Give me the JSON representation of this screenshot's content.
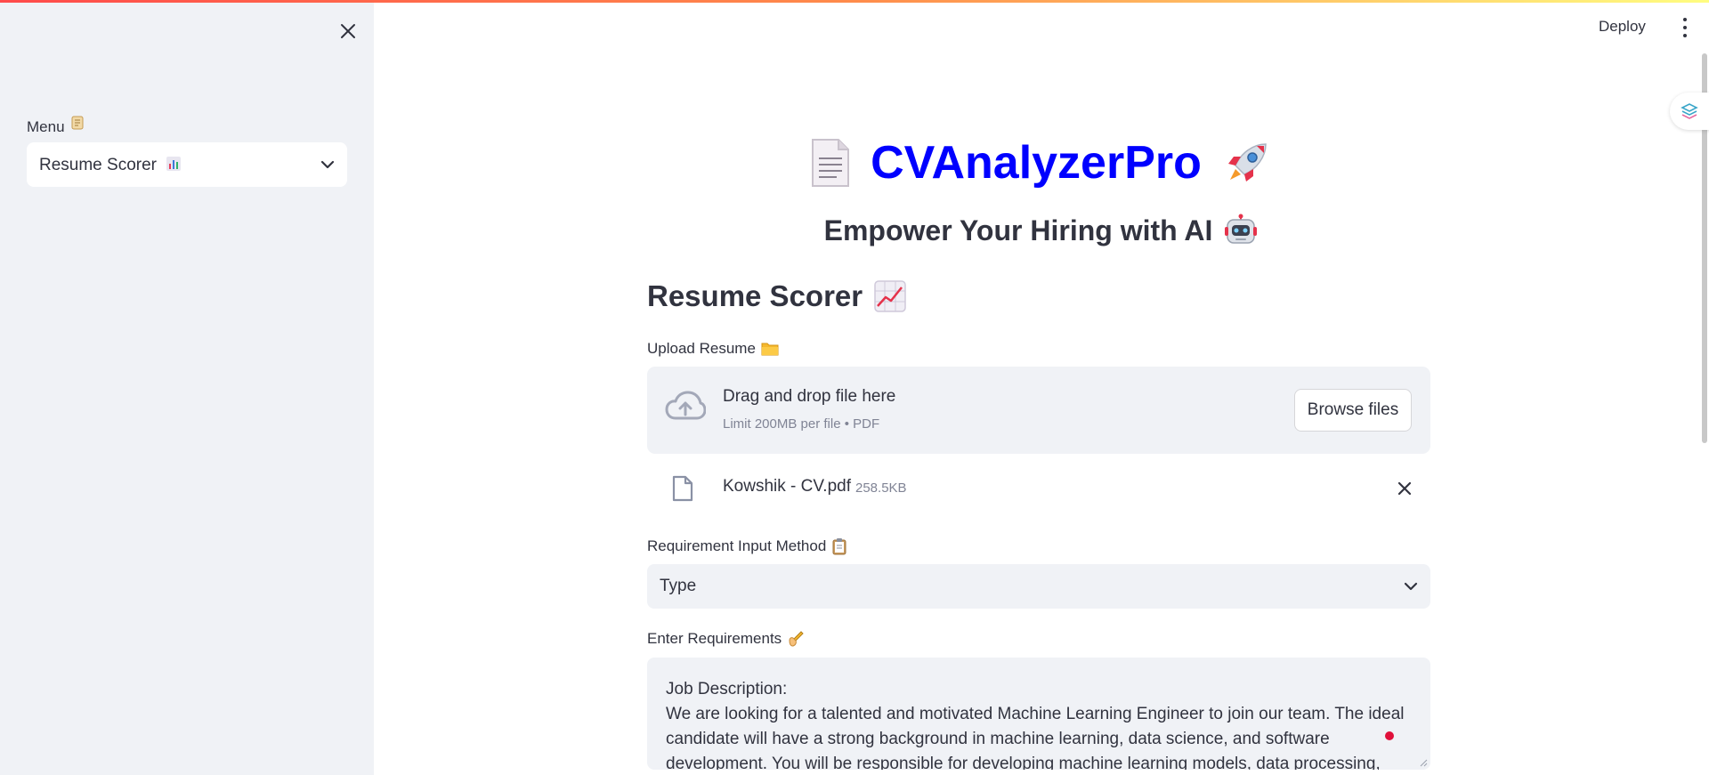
{
  "sidebar": {
    "menu_label": "Menu",
    "menu_selected": "Resume Scorer"
  },
  "header": {
    "deploy_label": "Deploy"
  },
  "main": {
    "title": "CVAnalyzerPro",
    "subtitle": "Empower Your Hiring with AI",
    "section_title": "Resume Scorer",
    "upload": {
      "label": "Upload Resume",
      "drop_text": "Drag and drop file here",
      "limit_text": "Limit 200MB per file • PDF",
      "browse_label": "Browse files"
    },
    "uploaded_file": {
      "name": "Kowshik - CV.pdf",
      "size": "258.5KB"
    },
    "requirement_method": {
      "label": "Requirement Input Method",
      "selected": "Type"
    },
    "requirements": {
      "label": "Enter Requirements",
      "line1": "Job Description:",
      "body": "We are looking for a talented and motivated Machine Learning Engineer to join our team. The ideal candidate will have a strong background in machine learning, data science, and software development. You will be responsible for developing machine learning models, data processing,"
    }
  },
  "colors": {
    "title": "#0000ff",
    "sidebar_bg": "#f0f2f6",
    "text": "#31333f",
    "muted": "#808495"
  },
  "icons": [
    "close-icon",
    "chevron-down-icon",
    "kebab-menu-icon",
    "document-icon",
    "rocket-icon",
    "robot-icon",
    "chart-up-icon",
    "folder-icon",
    "cloud-upload-icon",
    "file-icon",
    "clipboard-icon",
    "writing-hand-icon",
    "scroll-icon",
    "bar-chart-icon"
  ]
}
